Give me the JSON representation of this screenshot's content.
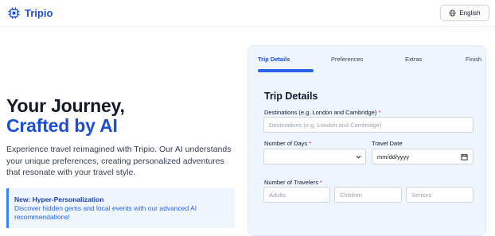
{
  "header": {
    "brand": "Tripio",
    "language": "English",
    "icons": {
      "logo": "chip-icon",
      "language": "globe-icon"
    }
  },
  "hero": {
    "title_line1": "Your Journey,",
    "title_line2": "Crafted by AI",
    "description": "Experience travel reimagined with Tripio. Our AI understands your unique preferences, creating personalized adventures that resonate with your travel style.",
    "callout_title": "New: Hyper-Personalization",
    "callout_text": "Discover hidden gems and local events with our advanced AI recommendations!"
  },
  "wizard": {
    "steps": [
      "Trip Details",
      "Preferences",
      "Extras",
      "Finish"
    ],
    "active_step": "Trip Details",
    "title": "Trip Details",
    "destinations_label": "Destinations (e.g. London and Cambridge)",
    "destinations_placeholder": "Destinations (e.g. London and Cambridge)",
    "days_label": "Number of Days",
    "travel_date_label": "Travel Date",
    "travel_date_placeholder": "mm/dd/yyyy",
    "travelers_label": "Number of Travelers",
    "travelers": {
      "adults": "Adults",
      "children": "Children",
      "seniors": "Seniors"
    },
    "required_mark": "*"
  },
  "colors": {
    "brand": "#1d4ed8",
    "panel_bg": "#eff6ff",
    "accent": "#2563eb",
    "required": "#dc2626"
  }
}
